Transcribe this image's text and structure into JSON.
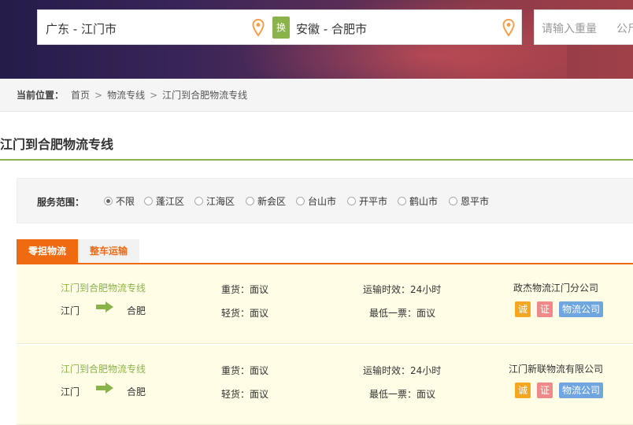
{
  "search": {
    "from_value": "广东 - 江门市",
    "to_value": "安徽 - 合肥市",
    "swap_label": "换",
    "weight_placeholder": "请输入重量",
    "weight_unit": "公斤"
  },
  "breadcrumb": {
    "label": "当前位置：",
    "items": [
      "首页",
      "物流专线",
      "江门到合肥物流专线"
    ],
    "separator": ">"
  },
  "page_title": "江门到合肥物流专线",
  "filter": {
    "label": "服务范围：",
    "options": [
      "不限",
      "蓬江区",
      "江海区",
      "新会区",
      "台山市",
      "开平市",
      "鹤山市",
      "恩平市"
    ],
    "selected": "不限"
  },
  "tabs": [
    "零担物流",
    "整车运输"
  ],
  "listings": [
    {
      "route": "江门到合肥物流专线",
      "from": "江门",
      "to": "合肥",
      "heavy": "重货：面议",
      "light": "轻货：面议",
      "transit": "运输时效：24小时",
      "min_ticket": "最低一票：面议",
      "company": "政杰物流江门分公司",
      "badges": [
        "诚",
        "证",
        "物流公司"
      ]
    },
    {
      "route": "江门到合肥物流专线",
      "from": "江门",
      "to": "合肥",
      "heavy": "重货：面议",
      "light": "轻货：面议",
      "transit": "运输时效：24小时",
      "min_ticket": "最低一票：面议",
      "company": "江门新联物流有限公司",
      "badges": [
        "诚",
        "证",
        "物流公司"
      ]
    }
  ],
  "colors": {
    "accent_orange": "#f06a12",
    "accent_green": "#8ab34a",
    "badge_cheng": "#f5a623",
    "badge_zheng": "#f08a8a",
    "badge_company": "#6fa6e0",
    "row_bg": "#fffde6"
  }
}
